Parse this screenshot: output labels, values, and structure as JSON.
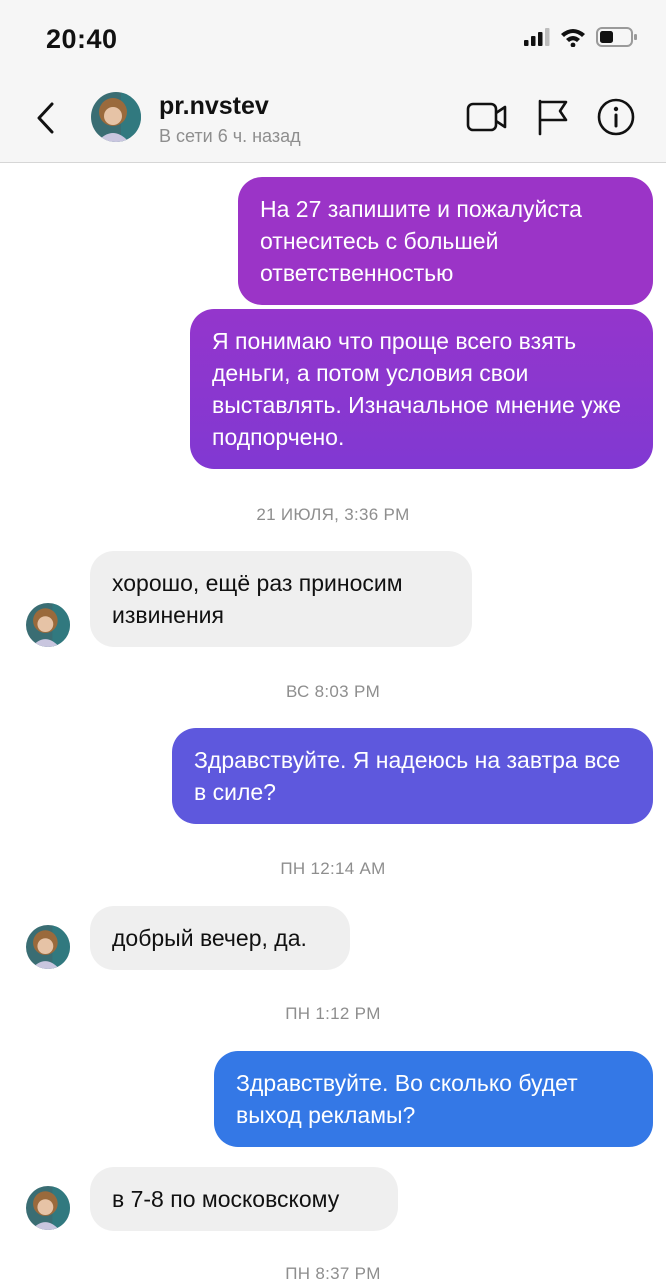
{
  "status_bar": {
    "time": "20:40",
    "icons": [
      "signal-icon",
      "wifi-icon",
      "battery-icon"
    ]
  },
  "header": {
    "username": "pr.nvstev",
    "presence": "В сети 6 ч. назад",
    "icons": [
      "back-chevron-icon",
      "video-call-icon",
      "flag-icon",
      "info-icon"
    ]
  },
  "messages": [
    {
      "side": "out",
      "text": "На 27 запишите и пожалуйста отнеситесь с большей ответственностью",
      "color": "#9b34c7"
    },
    {
      "side": "out",
      "text": "Я понимаю что проще всего взять деньги, а потом условия свои выставлять. Изначальное мнение уже подпорчено.",
      "color": "#8a36cf"
    },
    {
      "side": "stamp",
      "text": "21 ИЮЛЯ, 3:36 PM"
    },
    {
      "side": "in",
      "text": "хорошо, ещё раз приносим извинения"
    },
    {
      "side": "stamp",
      "text": "ВС 8:03 PM"
    },
    {
      "side": "out",
      "text": "Здравствуйте. Я надеюсь на завтра все в силе?",
      "color": "#5e58dd"
    },
    {
      "side": "stamp",
      "text": "ПН 12:14 AM"
    },
    {
      "side": "in",
      "text": "добрый вечер, да."
    },
    {
      "side": "stamp",
      "text": "ПН 1:12 PM"
    },
    {
      "side": "out",
      "text": "Здравствуйте. Во сколько будет выход рекламы?",
      "color": "#3478e6"
    },
    {
      "side": "in",
      "text": "в 7-8 по московскому"
    },
    {
      "side": "stamp",
      "text": "ПН 8:37 PM"
    }
  ],
  "colors": {
    "outgoing_purple": "#9b34c7",
    "outgoing_violet": "#8a36cf",
    "outgoing_indigo": "#5e58dd",
    "outgoing_blue": "#3478e6",
    "incoming_gray": "#efefef"
  }
}
